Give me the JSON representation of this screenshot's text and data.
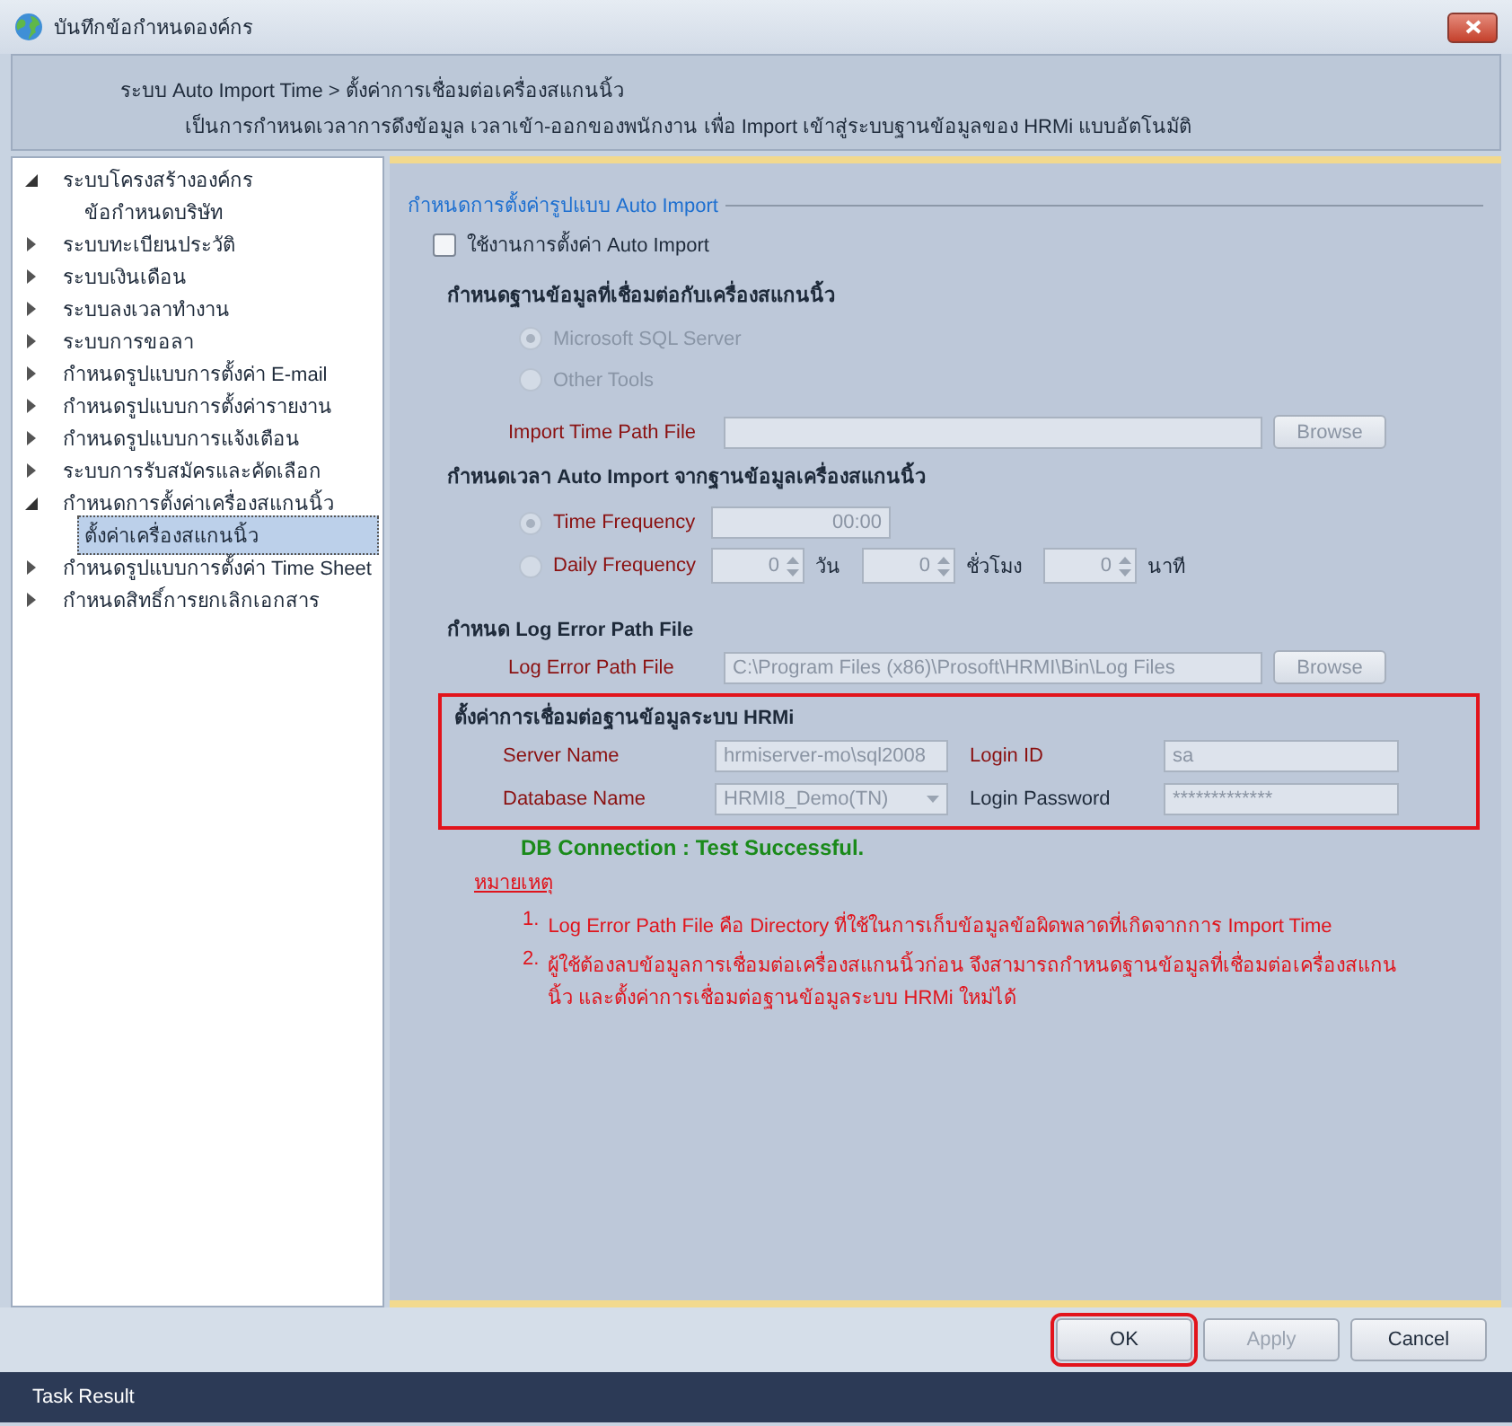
{
  "window": {
    "title": "บันทึกข้อกำหนดองค์กร"
  },
  "header": {
    "breadcrumb": "ระบบ Auto Import Time > ตั้งค่าการเชื่อมต่อเครื่องสแกนนิ้ว",
    "description": "เป็นการกำหนดเวลาการดึงข้อมูล เวลาเข้า-ออกของพนักงาน เพื่อ Import เข้าสู่ระบบฐานข้อมูลของ HRMi แบบอัตโนมัติ"
  },
  "tree": [
    {
      "label": "ระบบโครงสร้างองค์กร",
      "expanded": true,
      "selected": false,
      "children": [
        {
          "label": "ข้อกำหนดบริษัท",
          "selected": false
        }
      ]
    },
    {
      "label": "ระบบทะเบียนประวัติ",
      "expanded": false,
      "selected": false
    },
    {
      "label": "ระบบเงินเดือน",
      "expanded": false,
      "selected": false
    },
    {
      "label": "ระบบลงเวลาทำงาน",
      "expanded": false,
      "selected": false
    },
    {
      "label": "ระบบการขอลา",
      "expanded": false,
      "selected": false
    },
    {
      "label": "กำหนดรูปแบบการตั้งค่า E-mail",
      "expanded": false,
      "selected": false
    },
    {
      "label": "กำหนดรูปแบบการตั้งค่ารายงาน",
      "expanded": false,
      "selected": false
    },
    {
      "label": "กำหนดรูปแบบการแจ้งเตือน",
      "expanded": false,
      "selected": false
    },
    {
      "label": "ระบบการรับสมัครและคัดเลือก",
      "expanded": false,
      "selected": false
    },
    {
      "label": "กำหนดการตั้งค่าเครื่องสแกนนิ้ว",
      "expanded": true,
      "selected": false,
      "children": [
        {
          "label": "ตั้งค่าเครื่องสแกนนิ้ว",
          "selected": true
        }
      ]
    },
    {
      "label": "กำหนดรูปแบบการตั้งค่า Time Sheet",
      "expanded": false,
      "selected": false
    },
    {
      "label": "กำหนดสิทธิ์การยกเลิกเอกสาร",
      "expanded": false,
      "selected": false
    }
  ],
  "form": {
    "group_title": "กำหนดการตั้งค่ารูปแบบ Auto Import",
    "enable_checkbox": {
      "label": "ใช้งานการตั้งค่า Auto Import",
      "checked": false
    },
    "source_heading": "กำหนดฐานข้อมูลที่เชื่อมต่อกับเครื่องสแกนนิ้ว",
    "source_options": [
      {
        "label": "Microsoft SQL Server",
        "selected": true
      },
      {
        "label": "Other Tools",
        "selected": false
      }
    ],
    "import_path": {
      "label": "Import Time Path File",
      "button": "Browse"
    },
    "schedule_heading": "กำหนดเวลา **Auto Import** จากฐานข้อมูลเครื่องสแกนนิ้ว",
    "time_frequency": {
      "label": "Time Frequency",
      "selected": true,
      "value": "00:00"
    },
    "daily_frequency": {
      "label": "Daily Frequency",
      "selected": false,
      "spinners": [
        {
          "value": "0",
          "unit": "วัน"
        },
        {
          "value": "0",
          "unit": "ชั่วโมง"
        },
        {
          "value": "0",
          "unit": "นาที"
        }
      ]
    },
    "log_heading": "กำหนด **Log Error Path File**",
    "log_path": {
      "label": "Log Error Path File",
      "value": "C:\\Program Files (x86)\\Prosoft\\HRMI\\Bin\\Log Files",
      "button": "Browse"
    },
    "hrmi": {
      "heading": "ตั้งค่าการเชื่อมต่อฐานข้อมูลระบบ HRMi",
      "highlighted": true,
      "fields": [
        {
          "label": "Server Name",
          "value": "hrmiserver-mo\\sql2008",
          "kind": "text",
          "required": true
        },
        {
          "label": "Login ID",
          "value": "sa",
          "kind": "text",
          "required": true
        },
        {
          "label": "Database Name",
          "value": "HRMI8_Demo(TN)",
          "kind": "dropdown",
          "required": true
        },
        {
          "label": "Login Password",
          "value": "*************",
          "kind": "text",
          "required": false
        }
      ]
    },
    "status": "DB Connection : Test Successful.",
    "note_title": "หมายเหตุ",
    "notes": [
      {
        "number": "1.",
        "text": "Log Error Path File คือ Directory ที่ใช้ในการเก็บข้อมูลข้อผิดพลาดที่เกิดจากการ Import Time"
      },
      {
        "number": "2.",
        "text": "ผู้ใช้ต้องลบข้อมูลการเชื่อมต่อเครื่องสแกนนิ้วก่อน จึงสามารถกำหนดฐานข้อมูลที่เชื่อมต่อเครื่องสแกนนิ้ว และตั้งค่าการเชื่อมต่อฐานข้อมูลระบบ HRMi ใหม่ได้"
      }
    ]
  },
  "buttons": [
    {
      "label": "OK",
      "disabled": false,
      "highlighted": true
    },
    {
      "label": "Apply",
      "disabled": true,
      "highlighted": false
    },
    {
      "label": "Cancel",
      "disabled": false,
      "highlighted": false
    }
  ],
  "status_bar": "Task Result"
}
